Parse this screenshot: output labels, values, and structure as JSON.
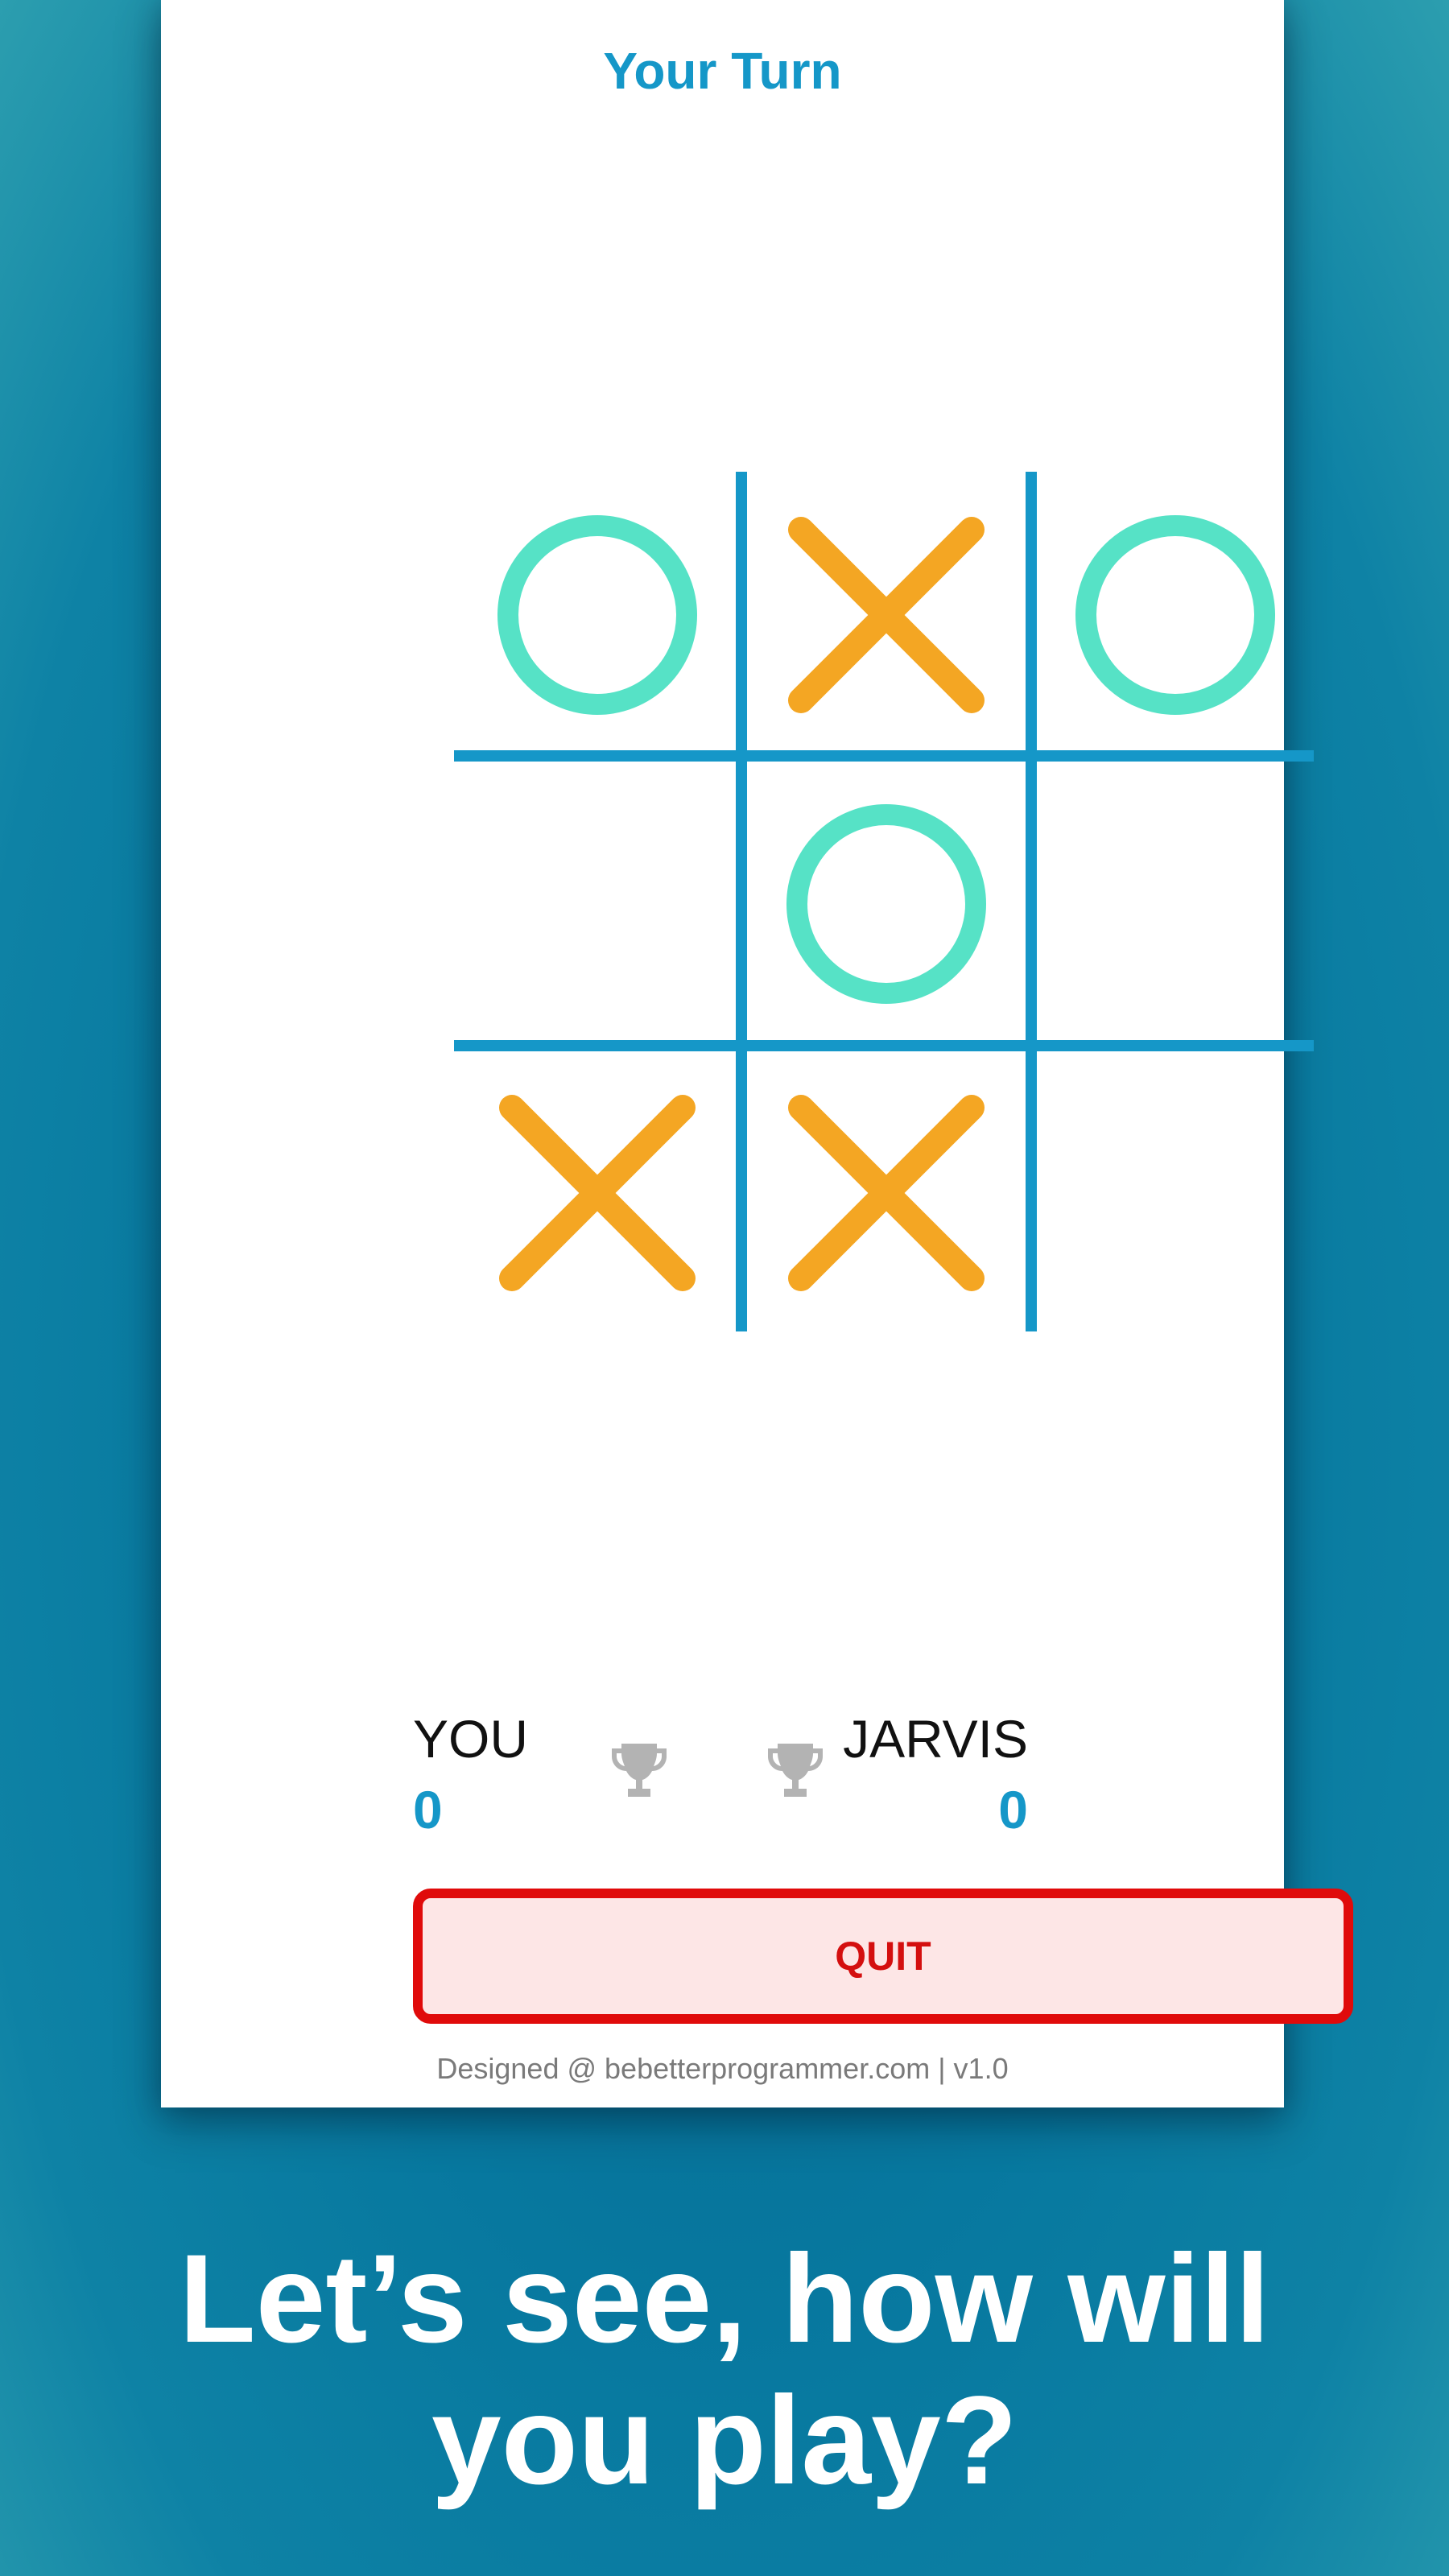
{
  "status": {
    "turn_label": "Your Turn"
  },
  "board": {
    "cells": [
      "O",
      "X",
      "O",
      "",
      "O",
      "",
      "X",
      "X",
      ""
    ],
    "colors": {
      "grid": "#1597c8",
      "x_mark": "#f4a623",
      "o_mark": "#56e2c6"
    }
  },
  "scoreboard": {
    "player_name": "YOU",
    "player_score": "0",
    "opponent_name": "JARVIS",
    "opponent_score": "0",
    "trophy_icon": "trophy-icon",
    "trophy_color": "#b3b3b3"
  },
  "actions": {
    "quit_label": "QUIT"
  },
  "footer": {
    "credit": "Designed @ bebetterprogrammer.com | v1.0"
  },
  "promo": {
    "line1": "Let’s see, how will",
    "line2": "you play?"
  }
}
